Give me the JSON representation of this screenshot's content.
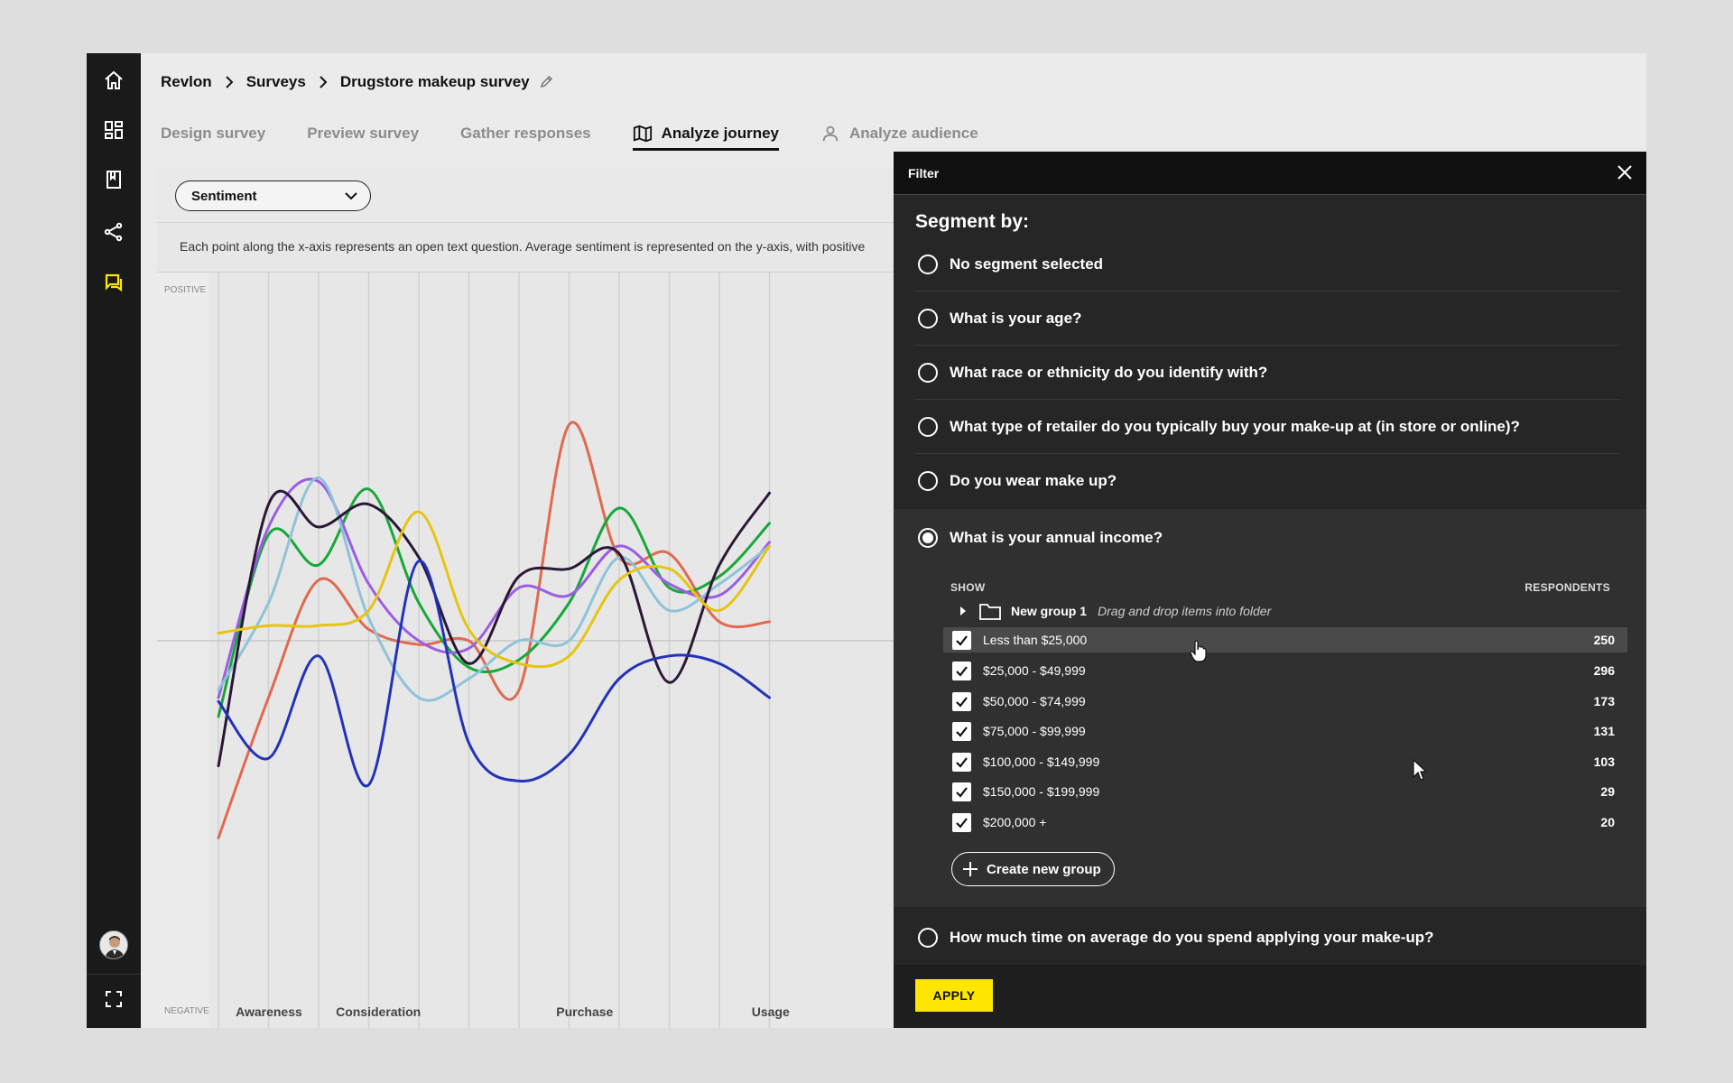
{
  "breadcrumb": [
    "Revlon",
    "Surveys",
    "Drugstore makeup survey"
  ],
  "tabs": [
    {
      "label": "Design survey",
      "icon": "",
      "active": false
    },
    {
      "label": "Preview survey",
      "icon": "",
      "active": false
    },
    {
      "label": "Gather responses",
      "icon": "",
      "active": false
    },
    {
      "label": "Analyze journey",
      "icon": "map-icon",
      "active": true
    },
    {
      "label": "Analyze audience",
      "icon": "person-icon",
      "active": false
    }
  ],
  "rail": {
    "icons": [
      "home-icon",
      "dashboard-icon",
      "book-icon",
      "share-icon",
      "chat-icon"
    ],
    "active_icon": "chat-icon",
    "accent": "#ffe600"
  },
  "chart_panel": {
    "select_value": "Sentiment",
    "description": "Each point along the x-axis represents an open text question. Average sentiment is represented on the y-axis, with positive"
  },
  "chart_data": {
    "type": "line",
    "ylabel_top": "POSITIVE",
    "ylabel_bottom": "NEGATIVE",
    "ylim": [
      -1,
      1
    ],
    "x": [
      1,
      2,
      3,
      4,
      5,
      6,
      7,
      8,
      9,
      10,
      11,
      12
    ],
    "stages": [
      {
        "label": "Awareness",
        "at": 1.2
      },
      {
        "label": "Consideration",
        "at": 3.2
      },
      {
        "label": "Purchase",
        "at": 7.6
      },
      {
        "label": "Usage",
        "at": 11.5
      }
    ],
    "series": [
      {
        "color": "#e06a50",
        "values": [
          -0.52,
          -0.15,
          0.16,
          0.03,
          -0.01,
          0.0,
          -0.13,
          0.57,
          0.22,
          0.23,
          0.05,
          0.05
        ]
      },
      {
        "color": "#18a83a",
        "values": [
          -0.2,
          0.28,
          0.2,
          0.4,
          0.1,
          -0.07,
          -0.05,
          0.1,
          0.35,
          0.14,
          0.17,
          0.31
        ]
      },
      {
        "color": "#9b5de5",
        "values": [
          -0.15,
          0.3,
          0.42,
          0.15,
          0.0,
          -0.02,
          0.14,
          0.12,
          0.25,
          0.15,
          0.12,
          0.26
        ]
      },
      {
        "color": "#8fc3d9",
        "values": [
          -0.13,
          0.1,
          0.43,
          0.06,
          -0.15,
          -0.1,
          0.0,
          0.0,
          0.22,
          0.08,
          0.15,
          0.25
        ]
      },
      {
        "color": "#2a1836",
        "values": [
          -0.33,
          0.36,
          0.3,
          0.36,
          0.22,
          -0.06,
          0.17,
          0.19,
          0.23,
          -0.11,
          0.2,
          0.39
        ]
      },
      {
        "color": "#e6c412",
        "values": [
          0.02,
          0.04,
          0.04,
          0.08,
          0.34,
          0.03,
          -0.06,
          -0.04,
          0.16,
          0.19,
          0.08,
          0.25
        ]
      },
      {
        "color": "#2233b8",
        "values": [
          -0.16,
          -0.31,
          -0.04,
          -0.38,
          0.21,
          -0.27,
          -0.37,
          -0.3,
          -0.1,
          -0.04,
          -0.06,
          -0.15
        ]
      }
    ]
  },
  "filter": {
    "title": "Filter",
    "segment_label": "Segment by:",
    "segments": [
      "No segment selected",
      "What is your age?",
      "What race or ethnicity do you identify with?",
      "What type of retailer do you typically buy your make-up at (in store or online)?",
      "Do you wear make up?"
    ],
    "selected_segment": "What is your annual income?",
    "show_header": "SHOW",
    "respondents_header": "RESPONDENTS",
    "group": {
      "name": "New group 1",
      "hint": "Drag and drop items into folder"
    },
    "income_options": [
      {
        "label": "Less than $25,000",
        "count": "250",
        "checked": true
      },
      {
        "label": "$25,000 - $49,999",
        "count": "296",
        "checked": true
      },
      {
        "label": "$50,000 - $74,999",
        "count": "173",
        "checked": true
      },
      {
        "label": "$75,000 - $99,999",
        "count": "131",
        "checked": true
      },
      {
        "label": "$100,000 - $149,999",
        "count": "103",
        "checked": true
      },
      {
        "label": "$150,000 - $199,999",
        "count": "29",
        "checked": true
      },
      {
        "label": "$200,000 +",
        "count": "20",
        "checked": true
      }
    ],
    "create_group_label": "Create new group",
    "last_segment": "How much time on average do you spend applying your make-up?",
    "apply_label": "APPLY",
    "apply_color": "#ffe600"
  }
}
